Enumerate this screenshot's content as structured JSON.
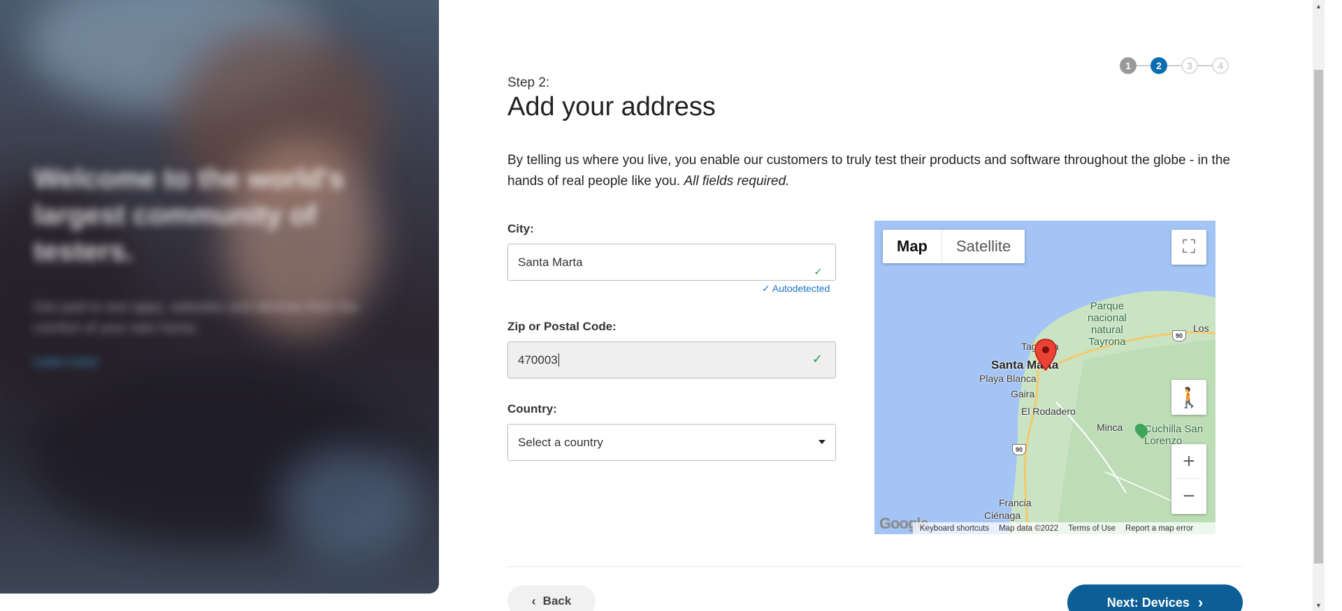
{
  "hero": {
    "title": "Welcome to the world's largest community of testers.",
    "subtitle": "Get paid to test apps, websites and devices from the comfort of your own home.",
    "link": "Learn more"
  },
  "steps": [
    "1",
    "2",
    "3",
    "4"
  ],
  "step_label": "Step 2:",
  "page_title": "Add your address",
  "intro_text": "By telling us where you live, you enable our customers to truly test their products and software throughout the globe - in the hands of real people like you. ",
  "intro_required": "All fields required.",
  "city": {
    "label": "City:",
    "value": "Santa Marta",
    "autodetected": "Autodetected"
  },
  "zip": {
    "label": "Zip or Postal Code:",
    "value": "470003"
  },
  "country": {
    "label": "Country:",
    "placeholder": "Select a country"
  },
  "map": {
    "type_map": "Map",
    "type_satellite": "Satellite",
    "labels": {
      "parque": "Parque\nnacional\nnatural\nTayrona",
      "los": "Los",
      "taganga": "Taganga",
      "santa_marta": "Santa Marta",
      "playa_blanca": "Playa Blanca",
      "gaira": "Gaira",
      "el_rodadero": "El Rodadero",
      "minca": "Minca",
      "cuchilla": "Cuchilla San\nLorenzo",
      "francia": "Francia",
      "cienaga": "Ciénaga"
    },
    "route_90_a": "90",
    "route_90_b": "90",
    "google": "Google",
    "footer": [
      "Keyboard shortcuts",
      "Map data ©2022",
      "Terms of Use",
      "Report a map error"
    ]
  },
  "back_label": "Back",
  "next_label": "Next: Devices",
  "colors": {
    "accent": "#0c5e96",
    "active_step": "#0a6db2",
    "success": "#2e9b4d",
    "link": "#1a73c8"
  }
}
